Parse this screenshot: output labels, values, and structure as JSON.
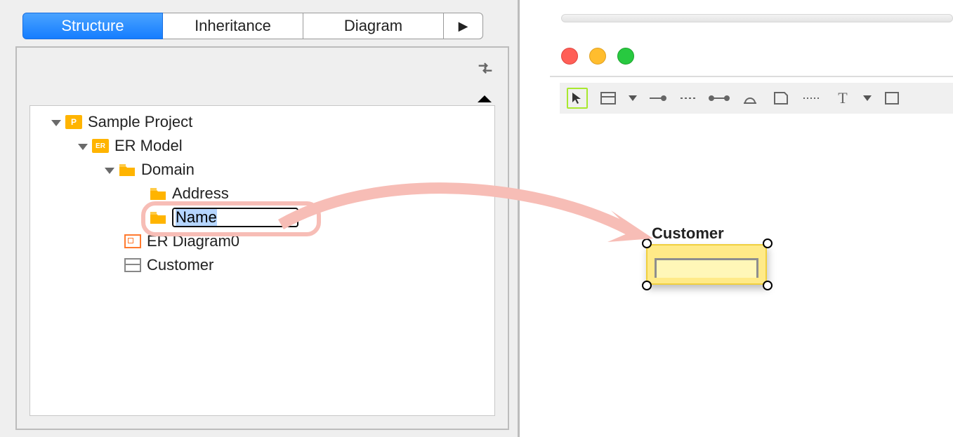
{
  "tabs": {
    "structure": "Structure",
    "inheritance": "Inheritance",
    "diagram": "Diagram",
    "more": "▶"
  },
  "tree": {
    "project": "Sample Project",
    "model": "ER Model",
    "domain": "Domain",
    "address": "Address",
    "name_edit": "Name",
    "diagram0": "ER Diagram0",
    "customer": "Customer"
  },
  "canvas": {
    "entity_label": "Customer"
  },
  "icons": {
    "p_label": "P",
    "er_label": "ER"
  }
}
